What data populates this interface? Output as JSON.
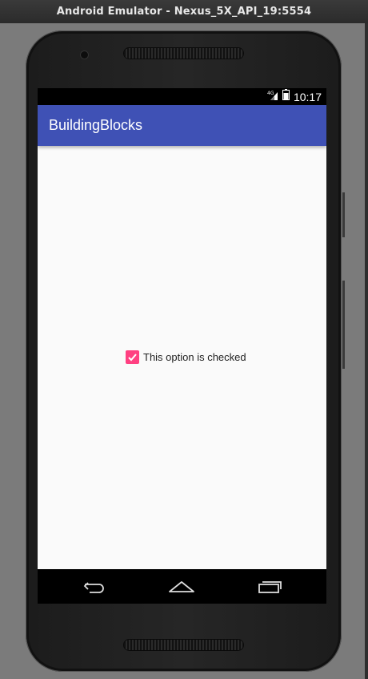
{
  "window": {
    "title": "Android Emulator - Nexus_5X_API_19:5554"
  },
  "status_bar": {
    "network_label": "4G",
    "time": "10:17"
  },
  "app_bar": {
    "title": "BuildingBlocks",
    "color": "#3f51b5"
  },
  "content": {
    "checkbox": {
      "label": "This option is checked",
      "checked": true,
      "color": "#ff4081"
    }
  },
  "nav_bar": {
    "buttons": [
      "back-icon",
      "home-icon",
      "recents-icon"
    ]
  }
}
